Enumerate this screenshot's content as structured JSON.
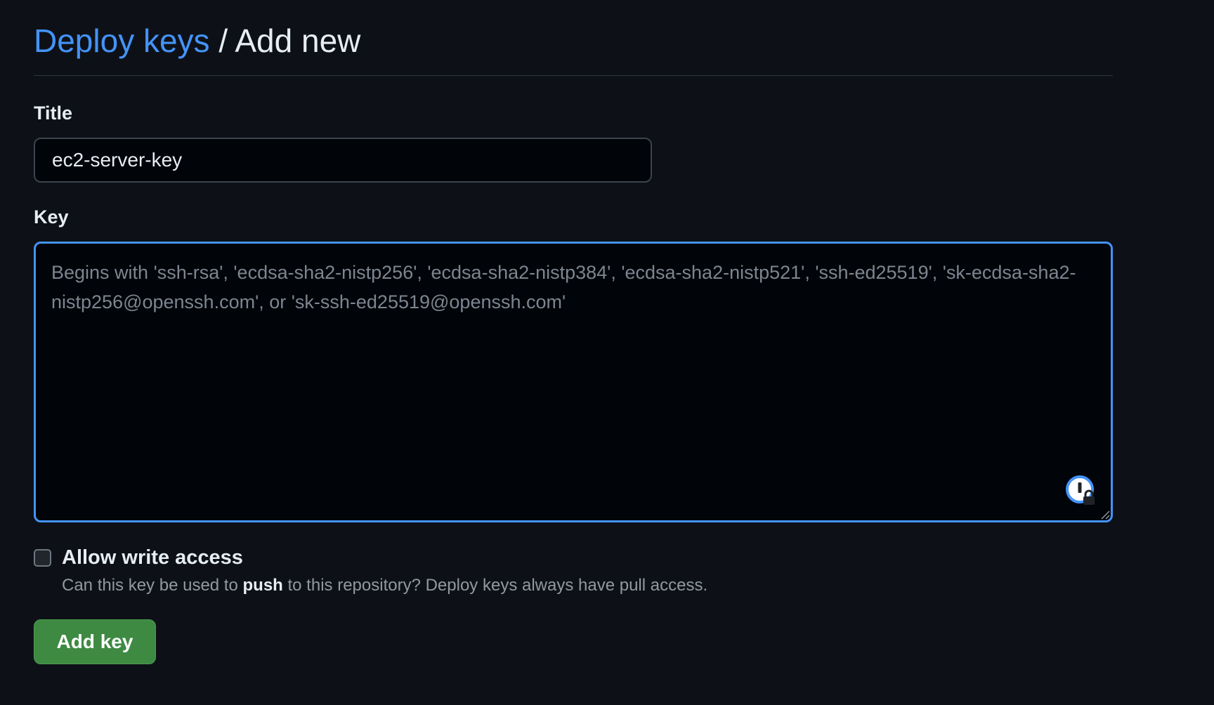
{
  "breadcrumb": {
    "parent": "Deploy keys",
    "separator": "/",
    "current": "Add new"
  },
  "form": {
    "title_label": "Title",
    "title_value": "ec2-server-key",
    "key_label": "Key",
    "key_placeholder": "Begins with 'ssh-rsa', 'ecdsa-sha2-nistp256', 'ecdsa-sha2-nistp384', 'ecdsa-sha2-nistp521', 'ssh-ed25519', 'sk-ecdsa-sha2-nistp256@openssh.com', or 'sk-ssh-ed25519@openssh.com'",
    "key_value": "",
    "write_access_label": "Allow write access",
    "write_access_checked": false,
    "write_access_note_prefix": "Can this key be used to",
    "write_access_note_bold": "push",
    "write_access_note_suffix": "to this repository? Deploy keys always have pull access.",
    "submit_label": "Add key"
  },
  "icons": {
    "password_manager": "1password-icon",
    "resize": "resize-handle-icon"
  },
  "colors": {
    "background": "#0d1117",
    "link": "#4493f8",
    "focus_border": "#4493f8",
    "primary_button": "#3e8a43"
  }
}
